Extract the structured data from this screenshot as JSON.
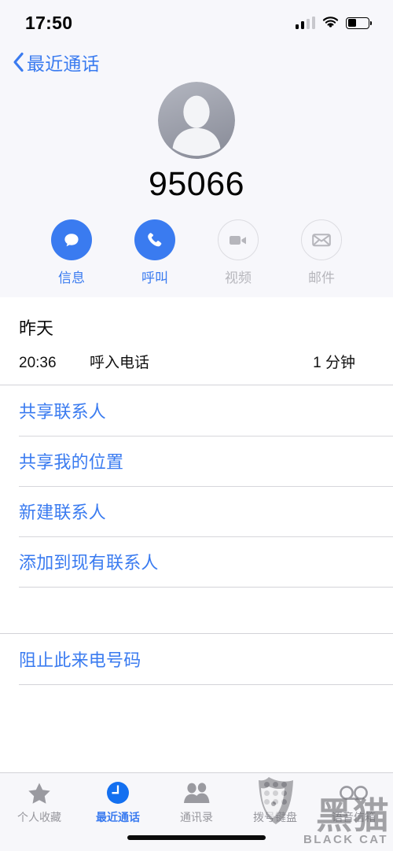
{
  "status_bar": {
    "time": "17:50",
    "signal_icon": "cellular-signal-icon",
    "wifi_icon": "wifi-icon",
    "battery_icon": "battery-icon",
    "battery_level_percent": 40
  },
  "navbar": {
    "back_label": "最近通话",
    "back_icon": "chevron-left-icon"
  },
  "contact": {
    "avatar_icon": "person-placeholder-avatar",
    "number": "95066"
  },
  "actions": [
    {
      "label": "信息",
      "icon": "message-bubble-icon",
      "enabled": true
    },
    {
      "label": "呼叫",
      "icon": "phone-handset-icon",
      "enabled": true
    },
    {
      "label": "视频",
      "icon": "video-camera-icon",
      "enabled": false
    },
    {
      "label": "邮件",
      "icon": "mail-envelope-icon",
      "enabled": false
    }
  ],
  "call_log": {
    "day": "昨天",
    "time": "20:36",
    "type": "呼入电话",
    "duration": "1 分钟"
  },
  "options": [
    "共享联系人",
    "共享我的位置",
    "新建联系人",
    "添加到现有联系人"
  ],
  "block_option": "阻止此来电号码",
  "tabbar": {
    "items": [
      {
        "label": "个人收藏",
        "icon": "star-icon",
        "active": false
      },
      {
        "label": "最近通话",
        "icon": "clock-icon",
        "active": true
      },
      {
        "label": "通讯录",
        "icon": "contacts-people-icon",
        "active": false
      },
      {
        "label": "拨号键盘",
        "icon": "dialpad-icon",
        "active": false
      },
      {
        "label": "语音信箱",
        "icon": "voicemail-icon",
        "active": false
      }
    ]
  },
  "watermark": {
    "cn": "黑猫",
    "en": "BLACK CAT",
    "logo_icon": "cat-shield-logo-icon"
  },
  "colors": {
    "accent_blue": "#3a7bf0",
    "header_bg": "#f7f7fb",
    "disabled_gray": "#b6b6bc"
  }
}
